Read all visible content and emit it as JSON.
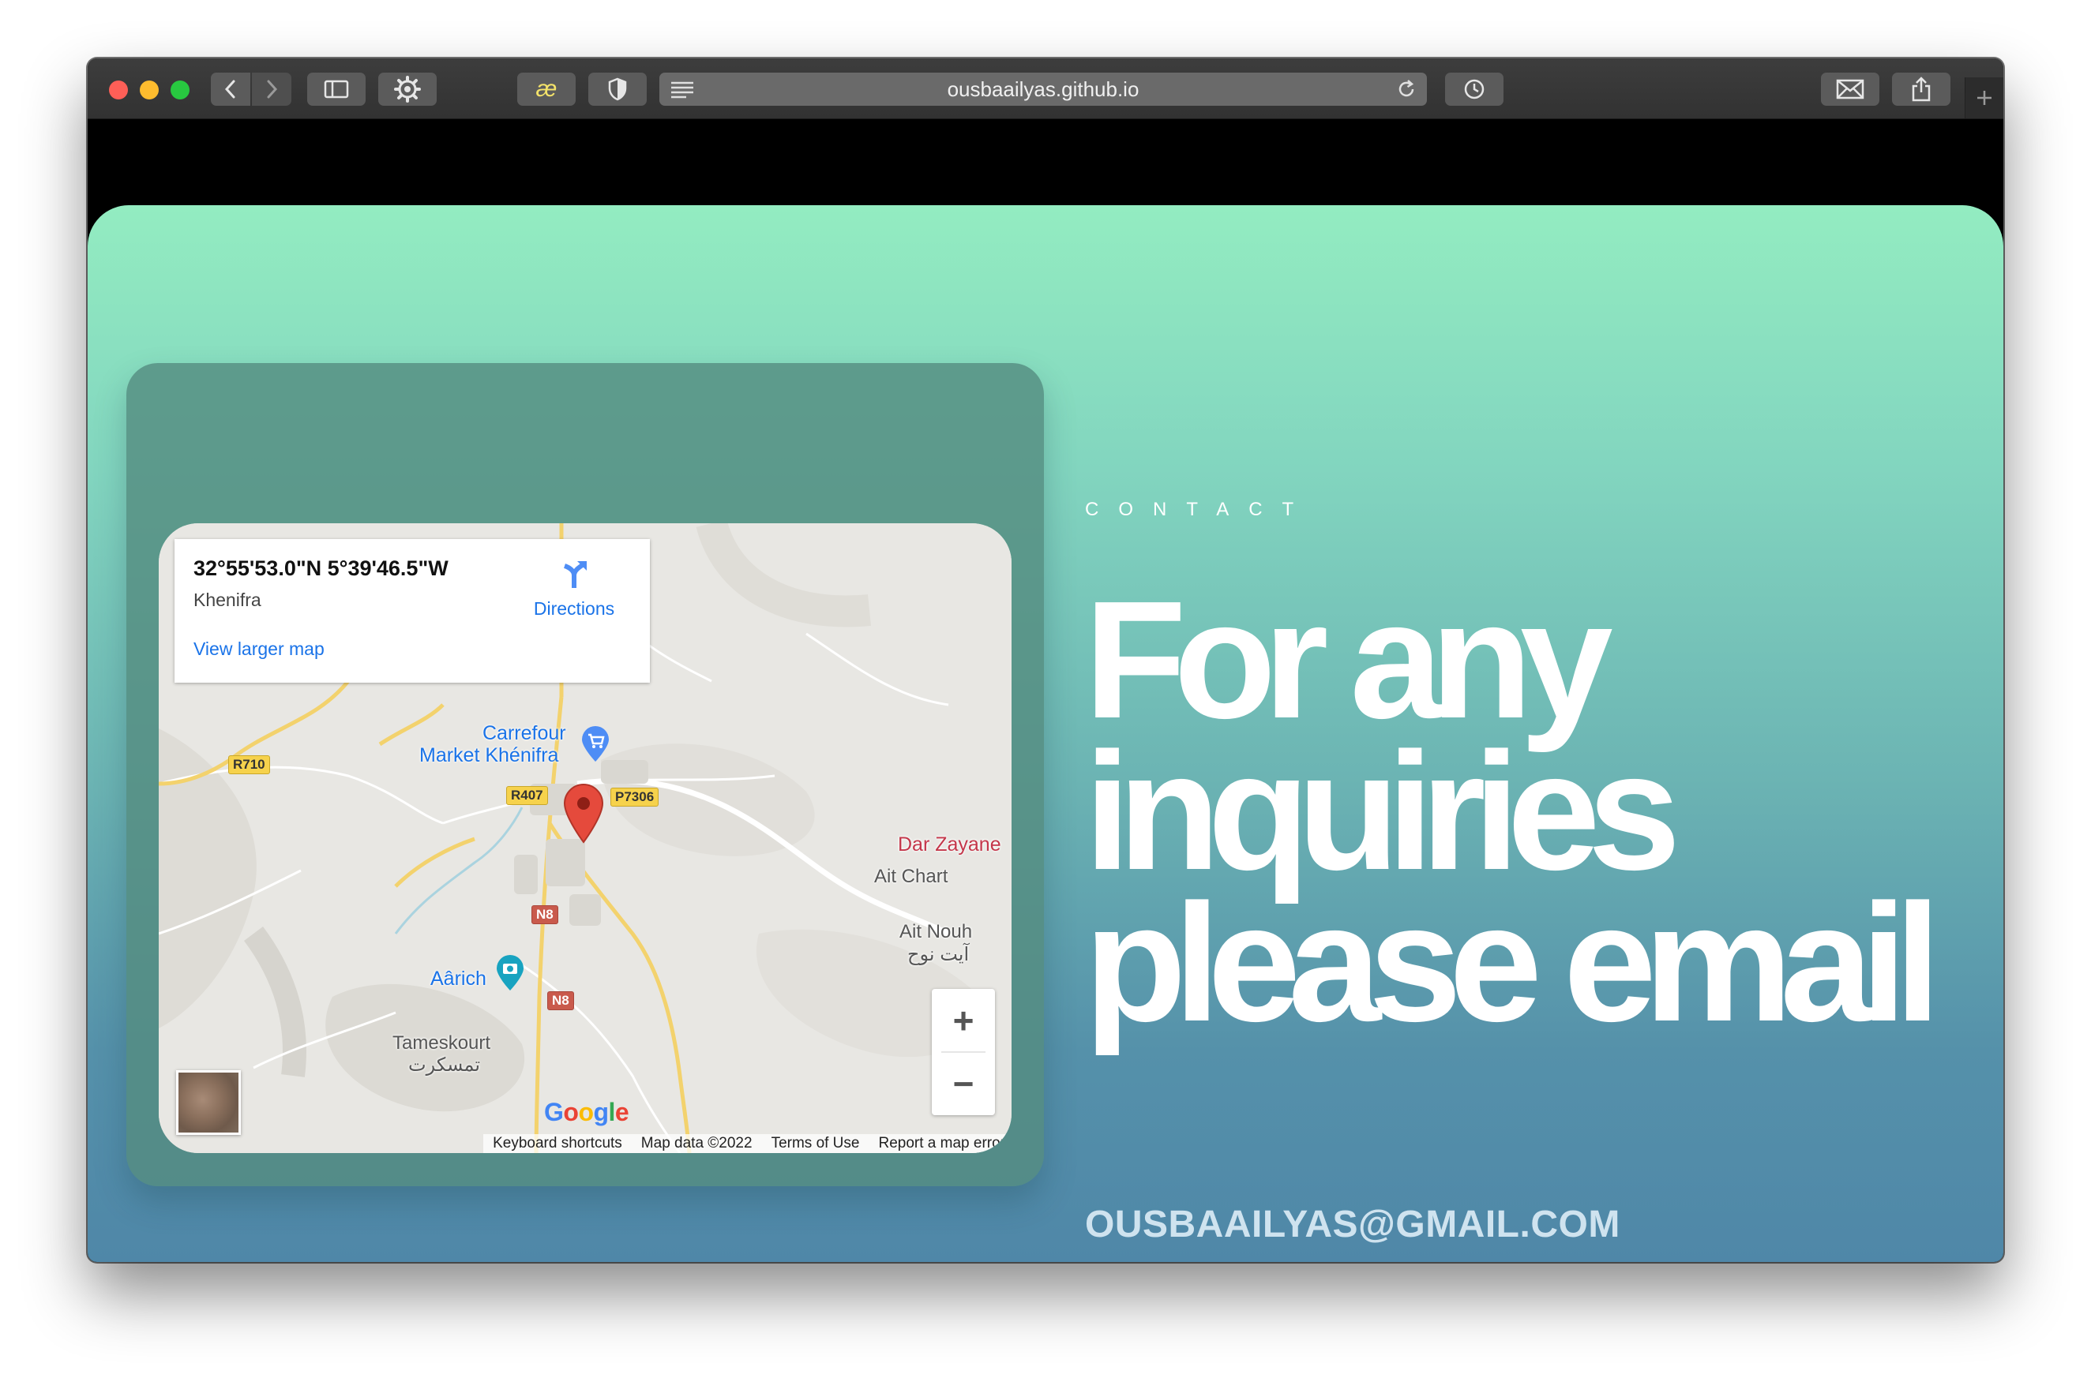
{
  "browser": {
    "url": "ousbaailyas.github.io",
    "extension_label": "æ"
  },
  "map": {
    "coordinates": "32°55'53.0\"N 5°39'46.5\"W",
    "place": "Khenifra",
    "directions_label": "Directions",
    "larger_map_label": "View larger map",
    "labels": {
      "carrefour_line1": "Carrefour",
      "carrefour_line2": "Market Khénifra",
      "dar_zayane": "Dar Zayane",
      "ait_chart": "Ait Chart",
      "ait_nouh": "Ait Nouh",
      "ait_nouh_ar": "آيت نوح",
      "aarich": "Aârich",
      "tameskourt": "Tameskourt",
      "tameskourt_ar": "تمسكرت"
    },
    "roads": {
      "r710": "R710",
      "r407": "R407",
      "p7306": "P7306",
      "n8_a": "N8",
      "n8_b": "N8"
    },
    "zoom_in": "+",
    "zoom_out": "−",
    "logo_letters": [
      "G",
      "o",
      "o",
      "g",
      "l",
      "e"
    ],
    "footer": {
      "shortcuts": "Keyboard shortcuts",
      "map_data": "Map data ©2022",
      "terms": "Terms of Use",
      "report": "Report a map error"
    }
  },
  "contact": {
    "eyebrow": "CONTACT",
    "headline_line1": "For any",
    "headline_line2": "inquiries",
    "headline_line3": "please email",
    "email": "OUSBAAILYAS@GMAIL.COM"
  },
  "colors": {
    "gradient_top": "#93ecc1",
    "gradient_bottom": "#4f87a8",
    "map_card": "#548c80",
    "link_blue": "#1a73e8",
    "marker_red": "#d93b30"
  }
}
